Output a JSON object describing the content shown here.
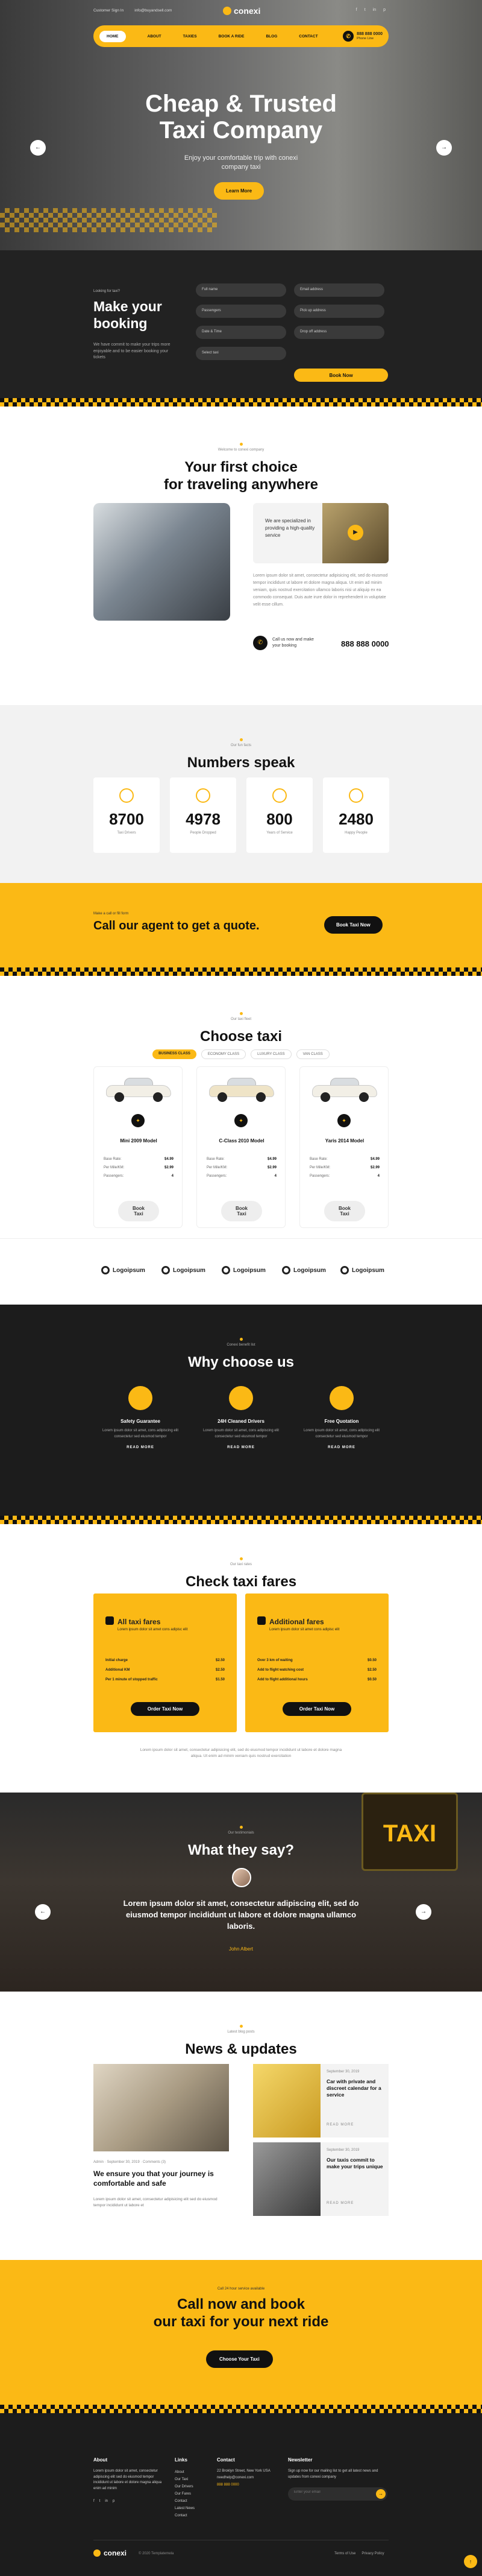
{
  "header": {
    "contact": "Customer Sign In",
    "email": "info@buyandsell.com",
    "logo": "conexi",
    "nav": [
      "HOME",
      "ABOUT",
      "TAXIES",
      "BOOK A RIDE",
      "BLOG",
      "CONTACT"
    ],
    "phone_label": "888 888 0000",
    "phone_sub": "Phone Line",
    "social": [
      "f",
      "t",
      "in",
      "p"
    ]
  },
  "hero": {
    "title1": "Cheap & Trusted",
    "title2": "Taxi Company",
    "sub": "Enjoy your comfortable trip with conexi company taxi",
    "button": "Learn More",
    "prev": "←",
    "next": "→"
  },
  "booking": {
    "label": "Looking for taxi?",
    "title1": "Make your",
    "title2": "booking",
    "desc": "We have commit to make your trips more enjoyable and to be easier booking your tickets",
    "fields": [
      "Full name",
      "Email address",
      "Passengers",
      "Pick up address",
      "Date & Time",
      "Drop off address",
      "Select taxi"
    ],
    "button": "Book Now"
  },
  "intro": {
    "kicker": "Welcome to conexi company",
    "title1": "Your first choice",
    "title2": "for traveling anywhere",
    "badge": "We are specialized in providing a high-quality service",
    "body": "Lorem ipsum dolor sit amet, consectetur adipisicing elit, sed do eiusmod tempor incididunt ut labore et dolore magna aliqua. Ut enim ad minim veniam, quis nostrud exercitation ullamco laboris nisi ut aliquip ex ea commodo consequat. Duis aute irure dolor in reprehenderit in voluptate velit esse cillum.",
    "call_label": "Call us now and make your booking",
    "phone": "888 888 0000"
  },
  "numbers": {
    "kicker": "Our fun facts",
    "title": "Numbers speak",
    "stats": [
      {
        "value": "8700",
        "label": "Taxi Drivers"
      },
      {
        "value": "4978",
        "label": "People Dropped"
      },
      {
        "value": "800",
        "label": "Years of Service"
      },
      {
        "value": "2480",
        "label": "Happy People"
      }
    ]
  },
  "quote": {
    "kicker": "Make a call or fill form",
    "title": "Call our agent to get a quote.",
    "button": "Book Taxi Now"
  },
  "taxi": {
    "kicker": "Our taxi fleet",
    "title": "Choose taxi",
    "filters": [
      "BUSINESS CLASS",
      "ECONOMY CLASS",
      "LUXURY CLASS",
      "VAN CLASS"
    ],
    "cars": [
      {
        "name": "Mini 2009 Model",
        "rows": [
          [
            "Base Rate:",
            "$4.99"
          ],
          [
            "Per Mile/KM:",
            "$2.99"
          ],
          [
            "Passengers:",
            "4"
          ]
        ],
        "button": "Book Taxi"
      },
      {
        "name": "C-Class 2010 Model",
        "rows": [
          [
            "Base Rate:",
            "$4.99"
          ],
          [
            "Per Mile/KM:",
            "$2.99"
          ],
          [
            "Passengers:",
            "4"
          ]
        ],
        "button": "Book Taxi"
      },
      {
        "name": "Yaris 2014 Model",
        "rows": [
          [
            "Base Rate:",
            "$4.99"
          ],
          [
            "Per Mile/KM:",
            "$2.99"
          ],
          [
            "Passengers:",
            "4"
          ]
        ],
        "button": "Book Taxi"
      }
    ]
  },
  "partners": [
    "Logoipsum",
    "Logoipsum",
    "Logoipsum",
    "Logoipsum",
    "Logoipsum"
  ],
  "why": {
    "kicker": "Conexi benefit list",
    "title": "Why choose us",
    "items": [
      {
        "title": "Safety Guarantee",
        "desc": "Lorem ipsum dolor sit amet, cons adipiscing elit consectetur sed eiusmod tempor",
        "link": "READ MORE"
      },
      {
        "title": "24H Cleaned Drivers",
        "desc": "Lorem ipsum dolor sit amet, cons adipiscing elit consectetur sed eiusmod tempor",
        "link": "READ MORE"
      },
      {
        "title": "Free Quotation",
        "desc": "Lorem ipsum dolor sit amet, cons adipiscing elit consectetur sed eiusmod tempor",
        "link": "READ MORE"
      }
    ]
  },
  "fares": {
    "kicker": "Our taxi rates",
    "title": "Check taxi fares",
    "cards": [
      {
        "title": "All taxi fares",
        "desc": "Lorem ipsum dolor sit amet cons adipisc elit",
        "rows": [
          [
            "Initial charge",
            "$2.50"
          ],
          [
            "Additional KM",
            "$2.50"
          ],
          [
            "Per 1 minute of stopped traffic",
            "$1.50"
          ]
        ],
        "button": "Order Taxi Now"
      },
      {
        "title": "Additional fares",
        "desc": "Lorem ipsum dolor sit amet cons adipisc elit",
        "rows": [
          [
            "Over 3 km of waiting",
            "$0.50"
          ],
          [
            "Add to flight watching cost",
            "$2.50"
          ],
          [
            "Add to flight additional hours",
            "$0.50"
          ]
        ],
        "button": "Order Taxi Now"
      }
    ],
    "note": "Lorem ipsum dolor sit amet, consectetur adipisicing elit, sed do eiusmod tempor incididunt ut labore et dolore magna aliqua. Ut enim ad minim veniam quis nostrud exercitation"
  },
  "testimonial": {
    "kicker": "Our testimonials",
    "title": "What they say?",
    "quote": "Lorem ipsum dolor sit amet, consectetur adipiscing elit, sed do eiusmod tempor incididunt ut labore et dolore magna ullamco laboris.",
    "author": "John Albert"
  },
  "news": {
    "kicker": "Latest blog posts",
    "title": "News & updates",
    "main": {
      "meta": "Admin · September 30, 2019 · Comments (3)",
      "title": "We ensure you that your journey is comfortable and safe",
      "body": "Lorem ipsum dolor sit amet, consectetur adipisicing elit sed do eiusmod tempor incididunt ut labore et"
    },
    "side": [
      {
        "meta": "September 30, 2019",
        "title": "Car with private and discreet calendar for a service",
        "link": "READ MORE"
      },
      {
        "meta": "September 30, 2019",
        "title": "Our taxis commit to make your trips unique",
        "link": "READ MORE"
      }
    ]
  },
  "cta": {
    "kicker": "Call 24 hour service available",
    "title1": "Call now and book",
    "title2": "our taxi for your next ride",
    "button": "Choose Your Taxi"
  },
  "footer": {
    "about_title": "About",
    "about": "Lorem ipsum dolor sit amet, consectetur adipiscing elit sed do eiusmod tempor incididunt ut labore et dolore magna aliqua enim ad minim",
    "links_title": "Links",
    "links": [
      "About",
      "Our Taxi",
      "Our Drivers",
      "Our Fares",
      "Contact",
      "Latest News",
      "Contact"
    ],
    "contact_title": "Contact",
    "contact": [
      "22 Broklyn Street, New York USA",
      "needhelp@conexi.com",
      "888 888 0000"
    ],
    "news_title": "Newsletter",
    "news_desc": "Sign up now for our mailing list to get all latest news and updates from conexi company",
    "email_placeholder": "Enter your email",
    "copyright": "© 2020 Templatemela",
    "legal": [
      "Terms of Use",
      "Privacy Policy"
    ],
    "logo": "conexi"
  }
}
